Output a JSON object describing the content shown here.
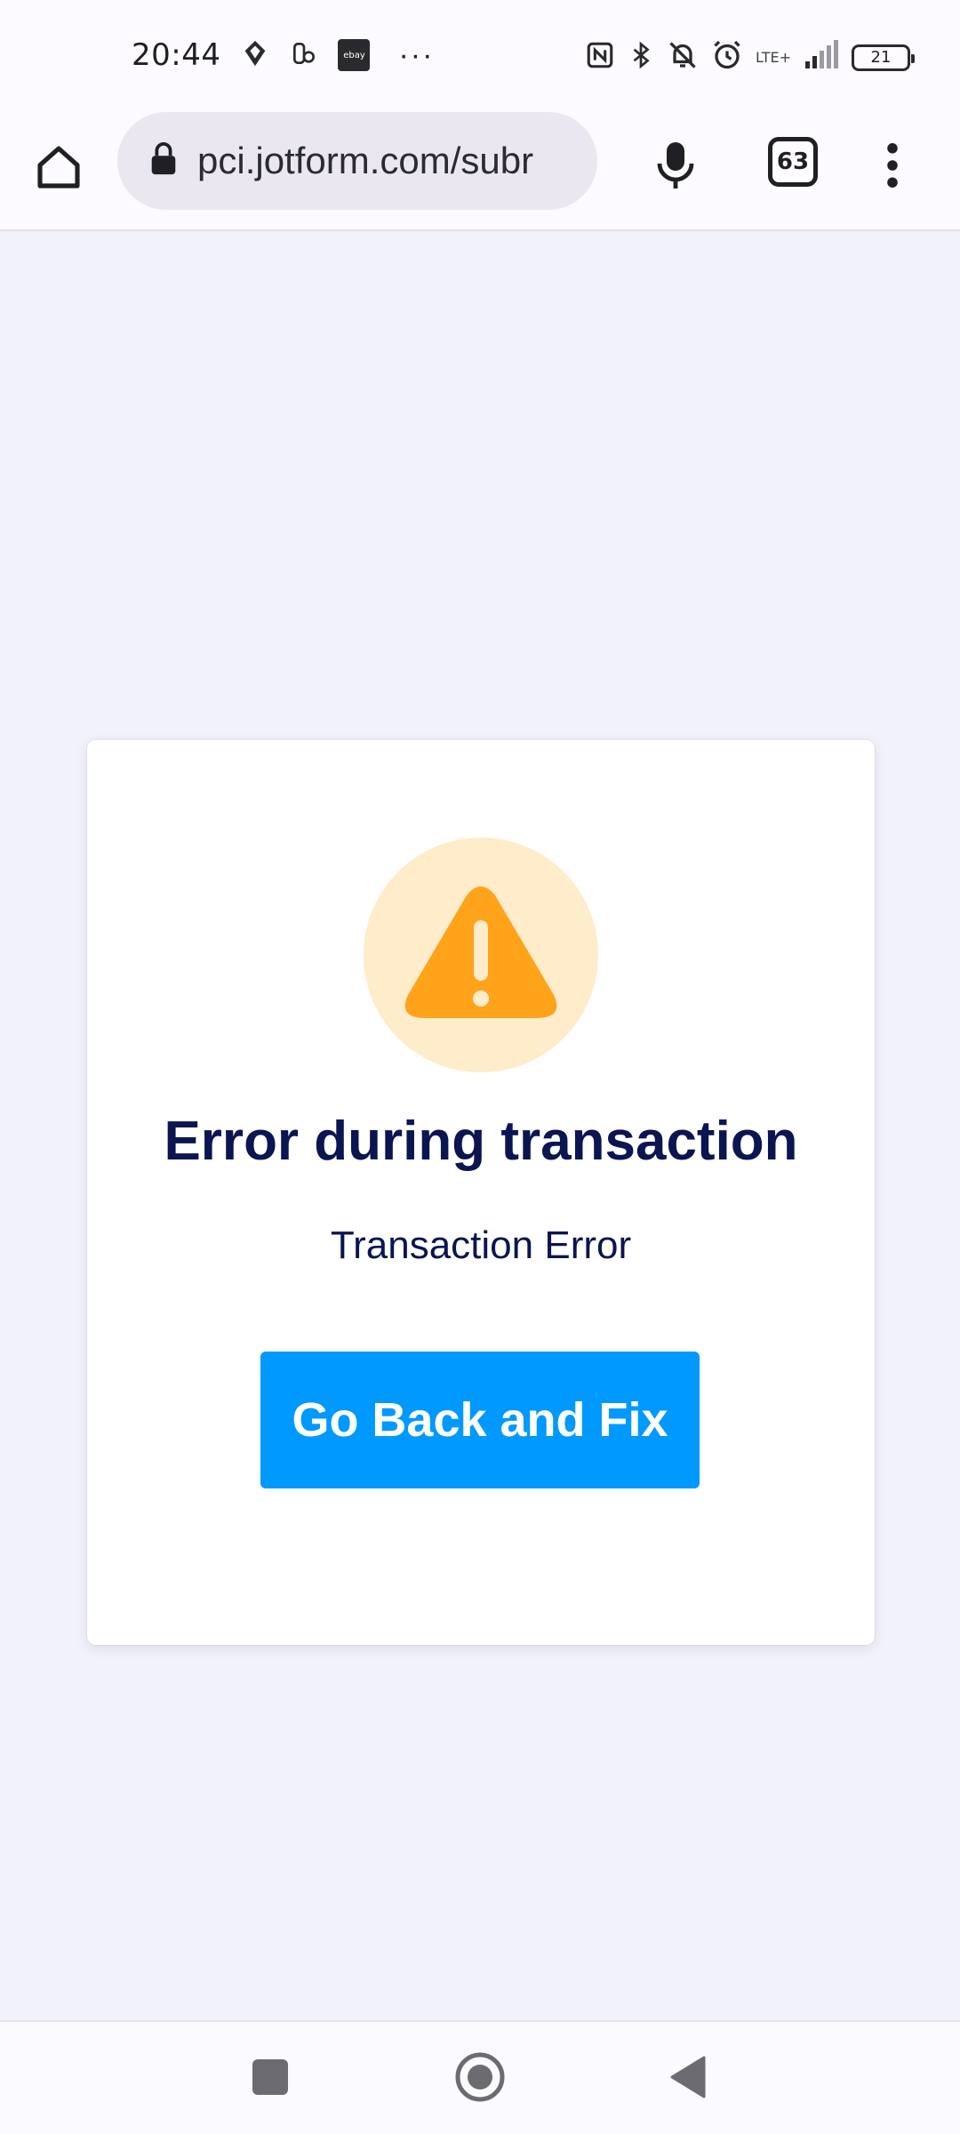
{
  "status_bar": {
    "time": "20:44",
    "ebay_label": "ebay",
    "more_label": "···",
    "network_label": "LTE+",
    "battery_level": "21"
  },
  "browser": {
    "url": "pci.jotform.com/subr",
    "tab_count": "63"
  },
  "card": {
    "title": "Error during transaction",
    "message": "Transaction Error",
    "button_label": "Go Back and Fix"
  },
  "colors": {
    "background": "#f1f2fb",
    "title": "#0a1551",
    "button": "#0099ff",
    "warning": "#ffa31a",
    "warning_bg": "#feeccb"
  },
  "icons": {
    "home": "home-icon",
    "lock": "lock-icon",
    "mic": "mic-icon",
    "menu": "more-vert-icon",
    "warning": "warning-icon"
  }
}
